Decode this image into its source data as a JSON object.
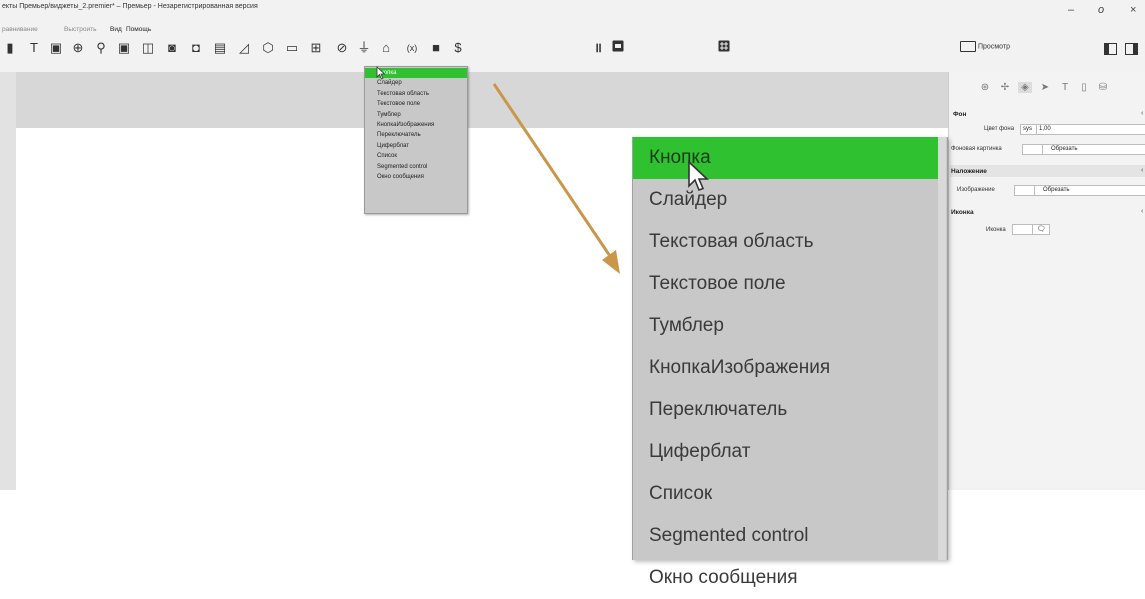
{
  "window": {
    "title": "екты Премьер/виджеты_2.premier* – Премьер - Незарегистрированная версия",
    "minimize": "–",
    "maximize": "o",
    "close": "×"
  },
  "menubar": {
    "items": [
      "равнивание",
      "Выстроить",
      "Вид",
      "Помощь"
    ]
  },
  "toolbar": {
    "left_icons": [
      "layout-icon",
      "text-icon",
      "image-icon",
      "globe-icon",
      "map-pin-icon",
      "media-icon",
      "copy-icon",
      "camera-icon",
      "video-icon",
      "chart-icon",
      "line-chart-icon",
      "cube-icon",
      "calendar-icon",
      "grid-icon",
      "check-circle-icon",
      "microphone-icon",
      "cloud-icon",
      "variable-icon",
      "stop-icon",
      "dollar-icon"
    ],
    "left_glyphs": [
      "▮",
      "T",
      "▣",
      "⊕",
      "⚲",
      "▣",
      "◫",
      "◙",
      "◘",
      "▤",
      "◿",
      "⬡",
      "▭",
      "⊞",
      "⊘",
      "⏚",
      "⌂",
      "(x)",
      "■",
      "$"
    ],
    "pause_glyph": "॥",
    "preview_label": "Просмотр"
  },
  "dropdown": {
    "items": [
      "Кнопка",
      "Слайдер",
      "Текстовая область",
      "Текстовое поле",
      "Тумблер",
      "КнопкаИзображения",
      "Переключатель",
      "Циферблат",
      "Список",
      "Segmented control",
      "Окно сообщения"
    ],
    "selected_index": 0
  },
  "inspector": {
    "tools_glyphs": [
      "⊛",
      "✢",
      "◈",
      "➤",
      "T",
      "▯",
      "⛁"
    ],
    "background": {
      "title": "Фон",
      "color_label": "Цвет фона",
      "color_sys": "sys",
      "color_value": "1,00",
      "image_label": "Фоновая картинка",
      "image_mode": "Обрезать"
    },
    "overlay": {
      "title": "Наложение",
      "image_label": "Изображение",
      "image_mode": "Обрезать"
    },
    "icon": {
      "title": "Иконка",
      "icon_label": "Иконка"
    }
  },
  "colors": {
    "accent_green": "#2fc12f",
    "arrow": "#c9964a"
  }
}
